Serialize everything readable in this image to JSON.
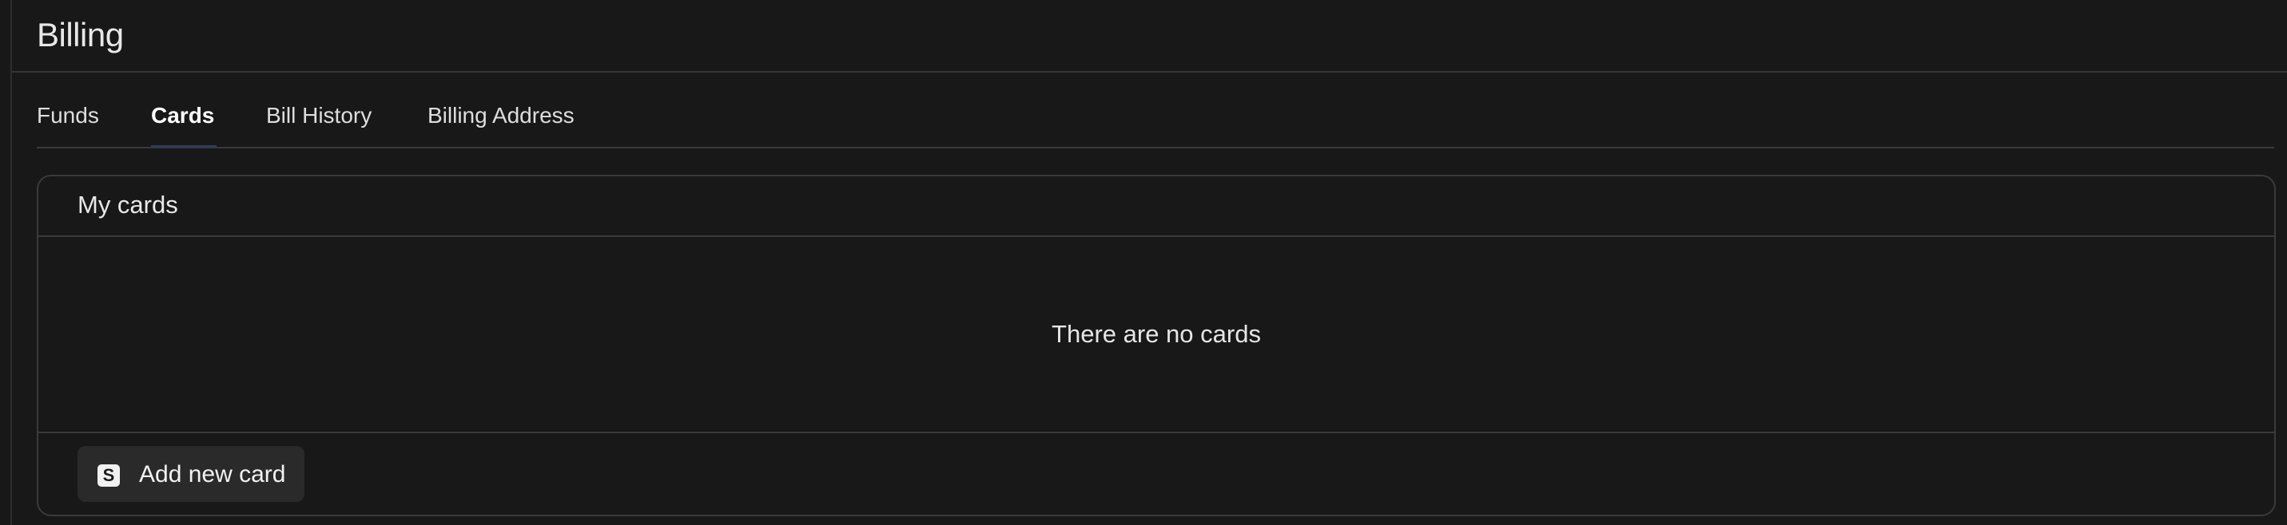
{
  "page": {
    "title": "Billing"
  },
  "tabs": [
    {
      "label": "Funds",
      "active": false
    },
    {
      "label": "Cards",
      "active": true
    },
    {
      "label": "Bill History",
      "active": false
    },
    {
      "label": "Billing Address",
      "active": false
    }
  ],
  "cards_panel": {
    "title": "My cards",
    "empty_message": "There are no cards",
    "add_button": {
      "label": "Add new card",
      "icon": "stripe-s-icon",
      "icon_glyph": "S"
    }
  },
  "colors": {
    "background": "#181818",
    "border": "#3a3a3a",
    "button_background": "#2a2a2a",
    "active_tab_underline": "#2d3b6e"
  }
}
